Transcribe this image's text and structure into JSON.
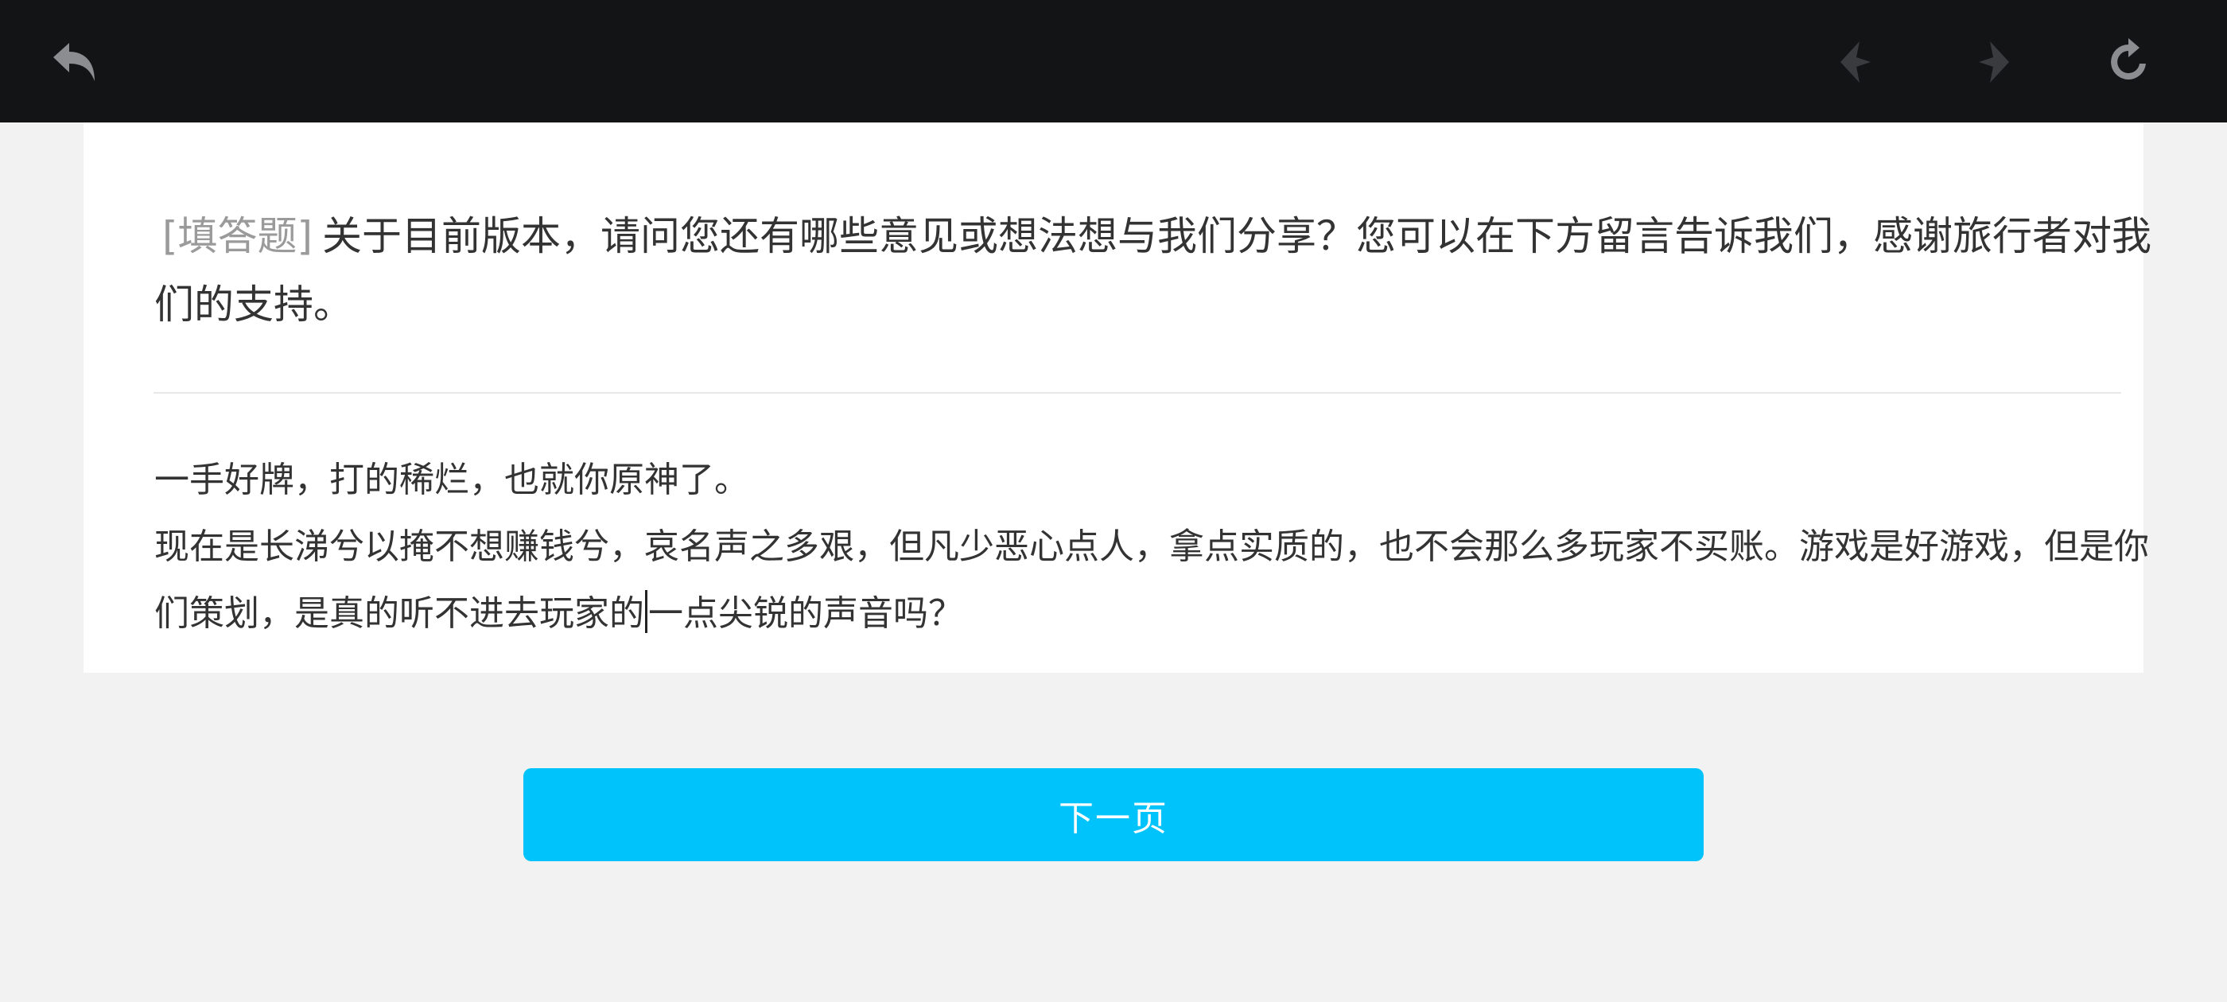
{
  "toolbar": {
    "back_icon": "undo-arrow-icon",
    "prev_icon": "chevron-left-icon",
    "next_icon": "chevron-right-icon",
    "refresh_icon": "refresh-icon"
  },
  "question": {
    "type_label": "[填答题]",
    "text": "关于目前版本，请问您还有哪些意见或想法想与我们分享？您可以在下方留言告诉我们，感谢旅行者对我们的支持。"
  },
  "answer": {
    "line1": "一手好牌，打的稀烂，也就你原神了。",
    "line2_before_caret": "现在是长涕兮以掩不想赚钱兮，哀名声之多艰，但凡少恶心点人，拿点实质的，也不会那么多玩家不买账。游戏是好游戏，但是你们策划，是真的听不进去玩家的",
    "line2_after_caret": "一点尖锐的声音吗？"
  },
  "footer": {
    "next_page_label": "下一页"
  },
  "colors": {
    "topbar": "#131416",
    "page_bg": "#f2f2f2",
    "card_bg": "#ffffff",
    "accent": "#00c3fc",
    "muted_text": "#9a9a9a"
  }
}
